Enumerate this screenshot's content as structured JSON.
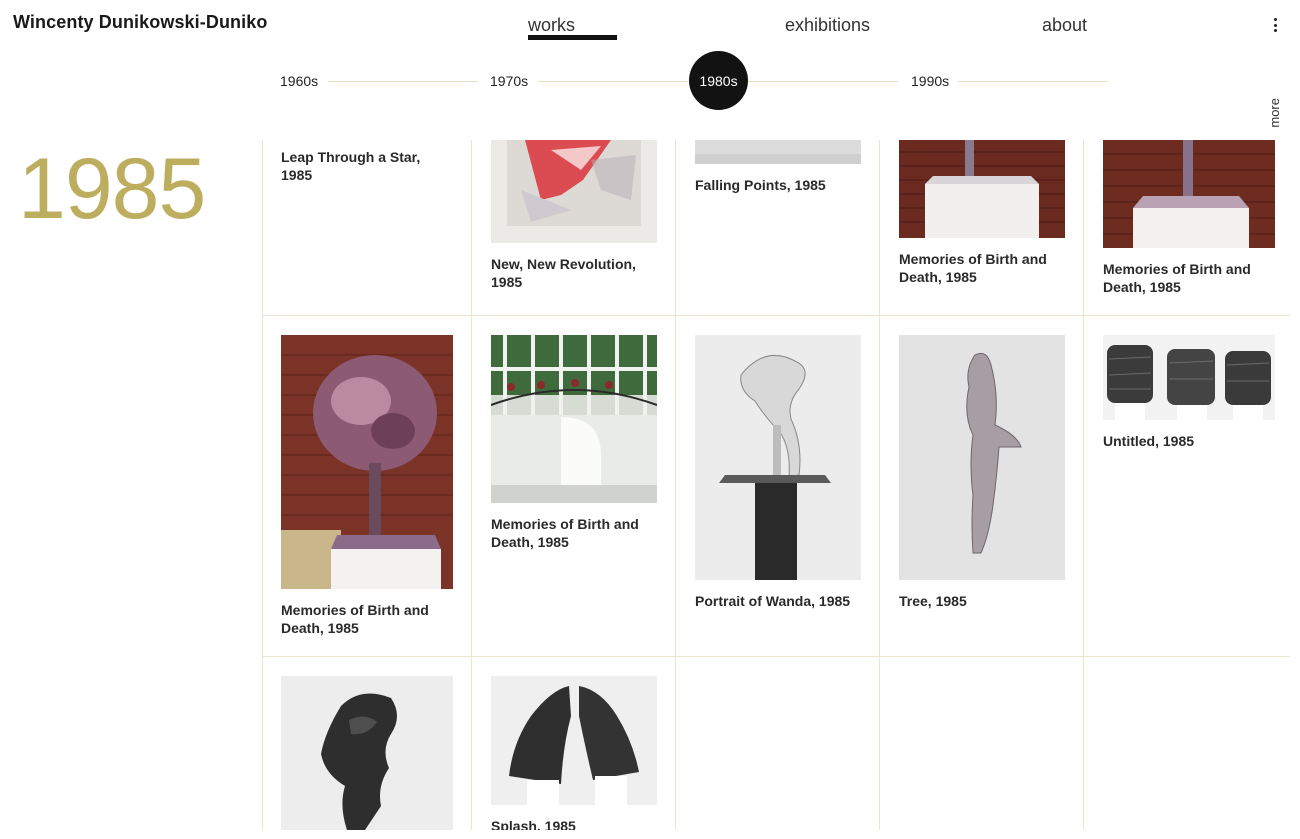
{
  "header": {
    "site_title": "Wincenty Dunikowski-Duniko",
    "nav": {
      "works": "works",
      "exhibitions": "exhibitions",
      "about": "about"
    },
    "active_nav": "works"
  },
  "timeline": {
    "decades": [
      "1960s",
      "1970s",
      "1980s",
      "1990s"
    ],
    "active": "1980s",
    "more_label": "more",
    "line_color": "#e6dfc2"
  },
  "year": {
    "label": "1985",
    "color": "#bdae5f"
  },
  "works": [
    {
      "title": "Leap Through a Star, 1985"
    },
    {
      "title": "New, New Revolution, 1985"
    },
    {
      "title": "Falling Points, 1985"
    },
    {
      "title": "Memories of Birth and Death, 1985"
    },
    {
      "title": "Memories of Birth and Death, 1985"
    },
    {
      "title": "Memories of Birth and Death, 1985"
    },
    {
      "title": "Memories of Birth and Death, 1985"
    },
    {
      "title": "Portrait of Wanda, 1985"
    },
    {
      "title": "Tree, 1985"
    },
    {
      "title": "Untitled, 1985"
    },
    {
      "title": ""
    },
    {
      "title": "Splash, 1985"
    }
  ]
}
